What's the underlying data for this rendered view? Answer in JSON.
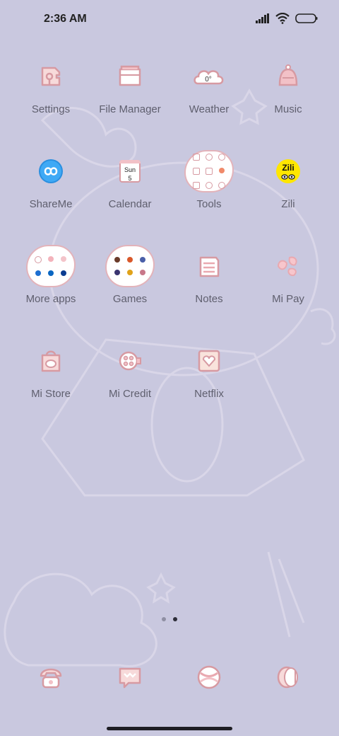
{
  "status_bar": {
    "time": "2:36 AM"
  },
  "apps": {
    "settings": "Settings",
    "file_manager": "File Manager",
    "weather": "Weather",
    "weather_temp": "0°",
    "music": "Music",
    "shareme": "ShareMe",
    "calendar": "Calendar",
    "calendar_day": "Sun",
    "calendar_date": "5",
    "tools": "Tools",
    "zili": "Zili",
    "zili_logo": "Zili",
    "more_apps": "More apps",
    "games": "Games",
    "notes": "Notes",
    "mi_pay": "Mi Pay",
    "mi_store": "Mi Store",
    "mi_credit": "Mi Credit",
    "netflix": "Netflix"
  },
  "pager": {
    "pages": 2,
    "active_index": 1
  },
  "dock": [
    "phone-icon",
    "messages-icon",
    "browser-icon",
    "camera-icon"
  ],
  "colors": {
    "background": "#c9c8df",
    "icon_pink": "#e3b3ba",
    "label": "#5f5f6e"
  }
}
